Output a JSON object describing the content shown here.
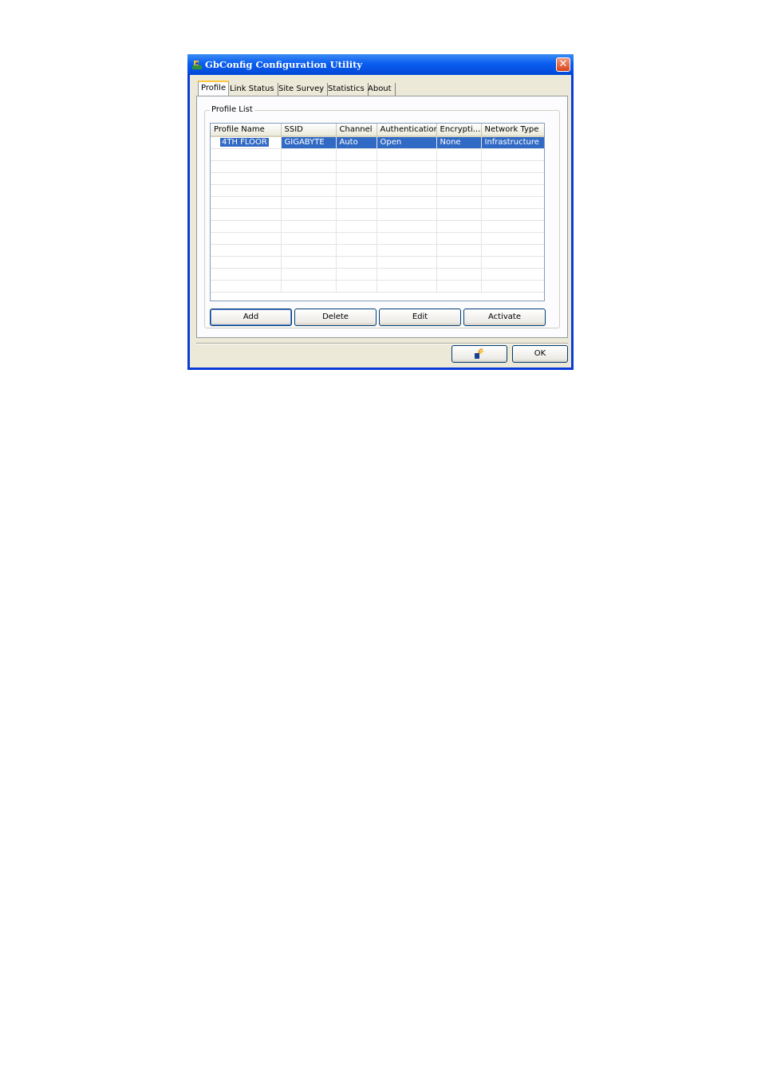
{
  "window": {
    "title": "GbConfig Configuration Utility",
    "close_glyph": "✕"
  },
  "tabs": [
    "Profile",
    "Link Status",
    "Site Survey",
    "Statistics",
    "About"
  ],
  "profile_list": {
    "group_label": "Profile List",
    "columns": [
      "Profile Name",
      "SSID",
      "Channel",
      "Authentication",
      "Encrypti...",
      "Network Type"
    ],
    "rows": [
      {
        "name": "4TH FLOOR",
        "ssid": "GIGABYTE",
        "channel": "Auto",
        "auth": "Open",
        "encryption": "None",
        "network_type": "Infrastructure",
        "selected": true
      }
    ]
  },
  "buttons": {
    "add": "Add",
    "delete": "Delete",
    "edit": "Edit",
    "activate": "Activate",
    "ok": "OK"
  },
  "icons": {
    "app": "wireless-app-icon",
    "tray": "wireless-signal-icon"
  },
  "colors": {
    "titlebar": "#0a5ef0",
    "selection": "#316ac5",
    "dialog": "#ece9d8"
  }
}
